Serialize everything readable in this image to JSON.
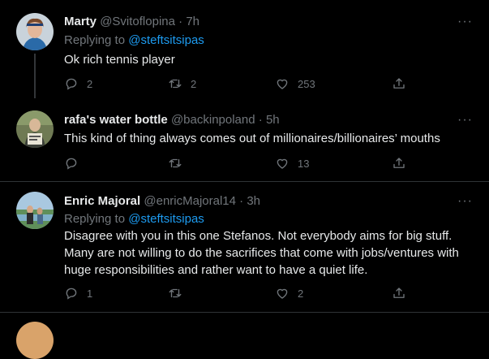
{
  "tweets": [
    {
      "name": "Marty",
      "handle": "@Svitoflopina",
      "time": "7h",
      "replying_label": "Replying to ",
      "replying_to": "@steftsitsipas",
      "text": "Ok rich tennis player",
      "reply_count": "2",
      "retweet_count": "2",
      "like_count": "253"
    },
    {
      "name": "rafa's water bottle",
      "handle": "@backinpoland",
      "time": "5h",
      "text": "This kind of thing always comes out of millionaires/billionaires’ mouths",
      "reply_count": "",
      "retweet_count": "",
      "like_count": "13"
    },
    {
      "name": "Enric Majoral",
      "handle": "@enricMajoral14",
      "time": "3h",
      "replying_label": "Replying to ",
      "replying_to": "@steftsitsipas",
      "text": "Disagree with you in this one Stefanos. Not everybody aims for big stuff. Many are not willing to do the sacrifices that come with jobs/ventures with huge responsibilities and rather want to have a quiet life.",
      "reply_count": "1",
      "retweet_count": "",
      "like_count": "2"
    }
  ],
  "separator": " · ",
  "more_glyph": "···",
  "icons": [
    "reply-icon",
    "retweet-icon",
    "like-icon",
    "share-icon",
    "more-icon"
  ],
  "colors": {
    "background": "#000000",
    "text": "#e7e9ea",
    "muted": "#71767b",
    "link": "#1d9bf0",
    "divider": "#2f3336"
  }
}
